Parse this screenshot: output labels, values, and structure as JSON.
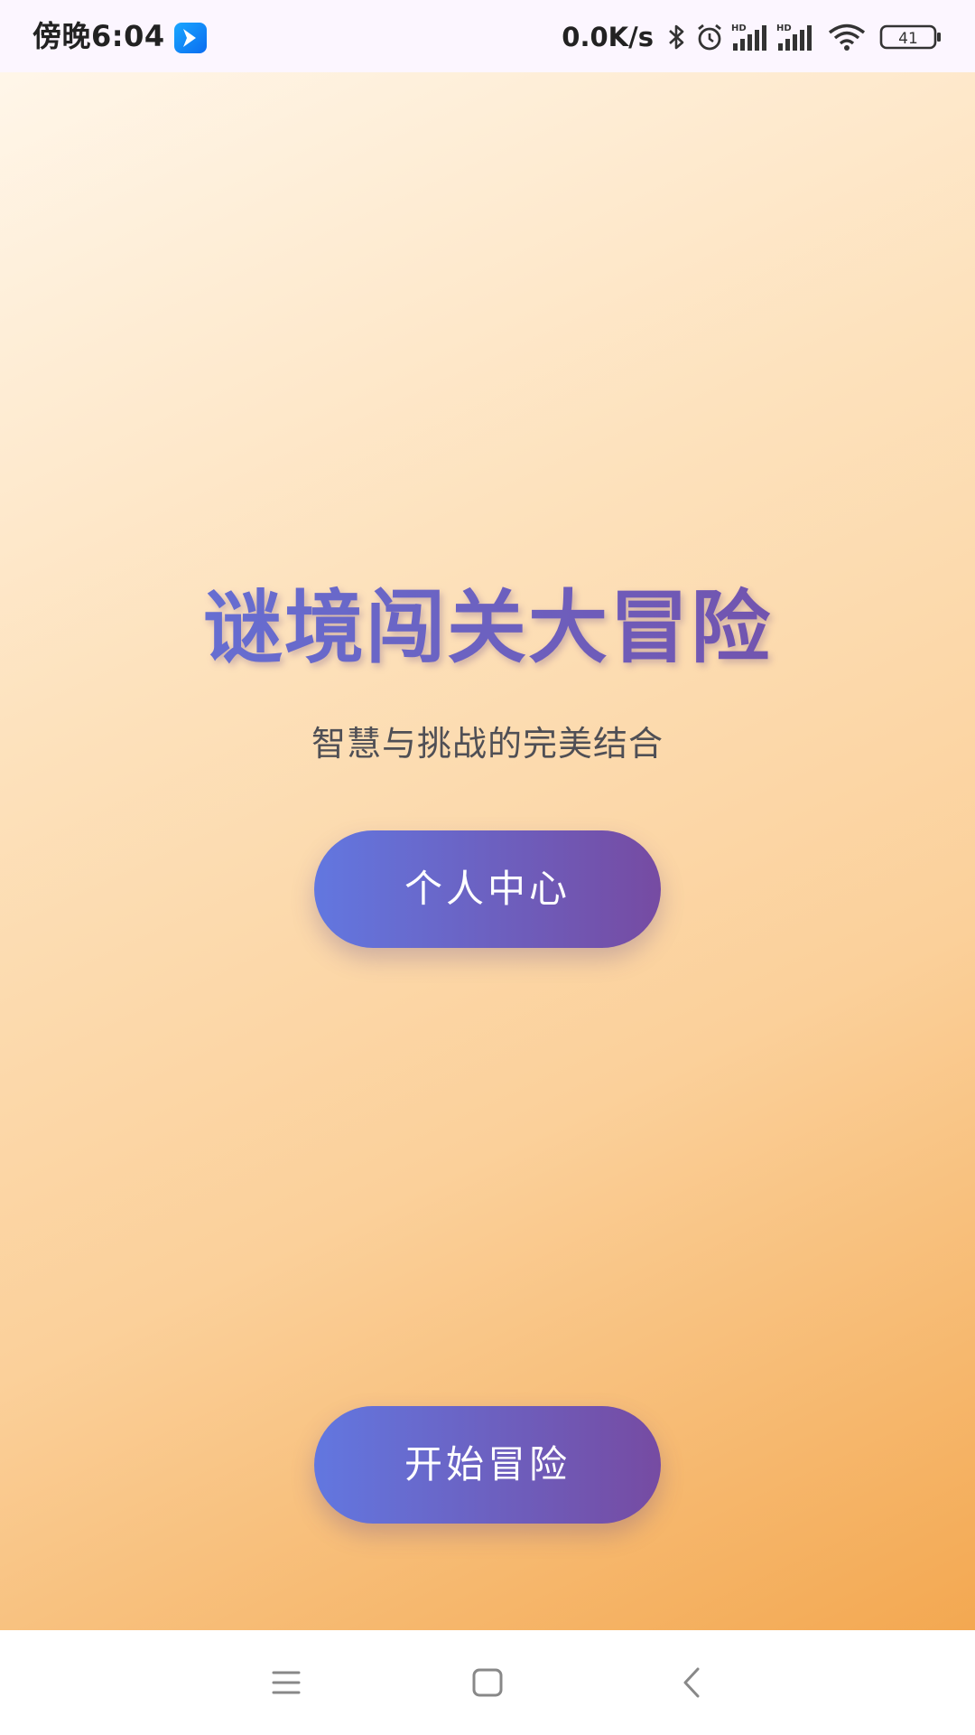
{
  "status_bar": {
    "time": "傍晚6:04",
    "app_icon": "app-notification-icon",
    "net_speed": "0.0K/s",
    "icons": [
      "bluetooth-icon",
      "alarm-icon",
      "hd-signal-icon",
      "hd-signal-icon",
      "wifi-icon",
      "battery-icon"
    ],
    "battery_level": "41"
  },
  "main": {
    "title": "谜境闯关大冒险",
    "subtitle": "智慧与挑战的完美结合",
    "profile_button": "个人中心",
    "start_button": "开始冒险",
    "colors": {
      "background_start": "#fff6e9",
      "background_end": "#f3a851",
      "accent_start": "#6277e0",
      "accent_end": "#764ba2"
    }
  },
  "nav_bar": {
    "buttons": [
      "menu-icon",
      "home-icon",
      "back-icon"
    ]
  }
}
